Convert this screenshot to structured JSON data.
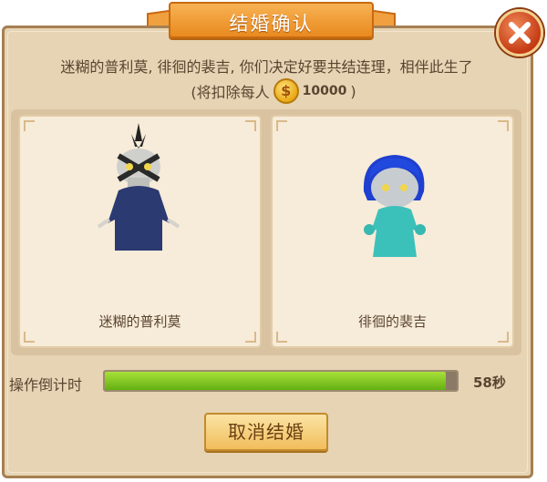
{
  "dialog": {
    "title": "结婚确认",
    "prompt": "迷糊的普利莫, 徘徊的裴吉, 你们决定好要共结连理，相伴此生了",
    "cost_prefix": "(将扣除每人",
    "cost_amount": "10000",
    "cost_suffix": ")",
    "coin_symbol": "$"
  },
  "partners": [
    {
      "name": "迷糊的普利莫",
      "avatar": "skull-wizard-avatar"
    },
    {
      "name": "徘徊的裴吉",
      "avatar": "blue-hair-ghost-avatar"
    }
  ],
  "timer": {
    "label": "操作倒计时",
    "value": "58秒",
    "progress_fraction": 0.97
  },
  "buttons": {
    "cancel": "取消结婚"
  },
  "colors": {
    "title_banner": "#e98a1f",
    "panel_bg": "#e6d4b4",
    "progress_fill": "#64b012",
    "close_button": "#c43a14"
  }
}
